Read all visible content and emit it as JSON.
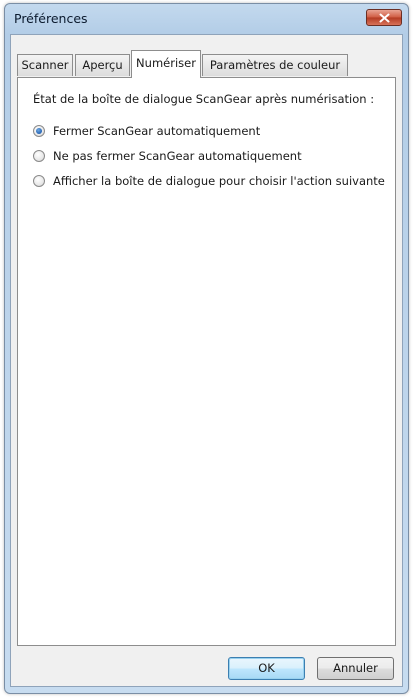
{
  "window": {
    "title": "Préférences"
  },
  "tabs": [
    {
      "label": "Scanner",
      "active": false
    },
    {
      "label": "Aperçu",
      "active": false
    },
    {
      "label": "Numériser",
      "active": true
    },
    {
      "label": "Paramètres de couleur",
      "active": false
    }
  ],
  "scan_tab": {
    "heading": "État de la boîte de dialogue ScanGear après numérisation :",
    "options": [
      {
        "label": "Fermer ScanGear automatiquement",
        "selected": true
      },
      {
        "label": "Ne pas fermer ScanGear automatiquement",
        "selected": false
      },
      {
        "label": "Afficher la boîte de dialogue pour choisir l'action suivante",
        "selected": false
      }
    ]
  },
  "buttons": {
    "ok_label": "OK",
    "cancel_label": "Annuler"
  },
  "icons": {
    "close": "close-icon",
    "radio_selected": "radio-selected-icon",
    "radio_unselected": "radio-unselected-icon"
  },
  "colors": {
    "title_bar": "#c3d9ee",
    "close_button": "#cf5a41",
    "radio_selected": "#2463b4",
    "default_button": "#bee6fd"
  }
}
